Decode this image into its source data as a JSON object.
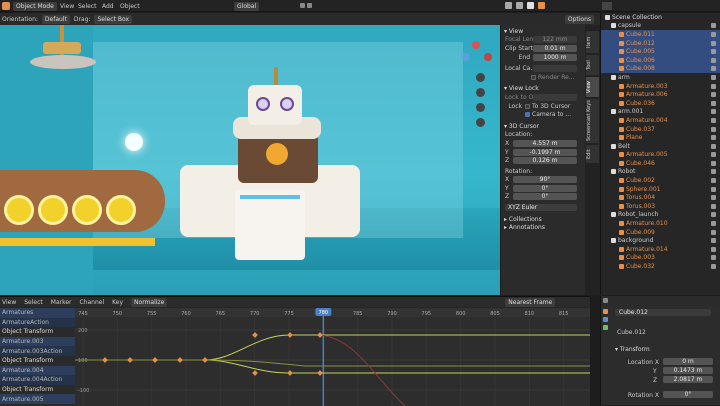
{
  "topbar": {
    "mode": "Object Mode",
    "view": "View",
    "select": "Select",
    "add": "Add",
    "object": "Object",
    "transform": "Global",
    "options": "Options"
  },
  "toolbar": {
    "orientation": "Orientation:",
    "default": "Default",
    "drag": "Drag:",
    "select_box": "Select Box"
  },
  "npanel": {
    "view_header": "View",
    "focal_label": "Focal Length",
    "focal_value": "122 mm",
    "clip_start_label": "Clip Start",
    "clip_start_value": "0.01 m",
    "end_label": "End",
    "end_value": "1000 m",
    "local_camera_label": "Local Ca...",
    "render_region": "Render Re...",
    "view_lock_header": "View Lock",
    "lock_to_object": "Lock to O...",
    "lock_label": "Lock",
    "to_3d_cursor": "To 3D Cursor",
    "camera_to_view": "Camera to ...",
    "cursor_header": "3D Cursor",
    "location_label": "Location:",
    "cursor_x": "4.557 m",
    "cursor_y": "-0.1997 m",
    "cursor_z": "0.126 m",
    "rotation_label": "Rotation:",
    "rot_x": "90°",
    "rot_y": "0°",
    "rot_z": "0°",
    "rotation_mode": "XYZ Euler",
    "collections": "Collections",
    "annotations": "Annotations"
  },
  "side_tabs": [
    "Item",
    "Tool",
    "View",
    "Screencast Keys",
    "Edit"
  ],
  "outliner": {
    "title": "Scene Collection",
    "items": [
      {
        "label": "capsule",
        "kind": "collection"
      },
      {
        "label": "Cube.011",
        "kind": "mesh"
      },
      {
        "label": "Cube.012",
        "kind": "mesh"
      },
      {
        "label": "Cube.005",
        "kind": "mesh"
      },
      {
        "label": "Cube.006",
        "kind": "mesh"
      },
      {
        "label": "Cube.008",
        "kind": "mesh"
      },
      {
        "label": "arm",
        "kind": "collection"
      },
      {
        "label": "Armature.003",
        "kind": "armature"
      },
      {
        "label": "Armature.006",
        "kind": "armature"
      },
      {
        "label": "Cube.036",
        "kind": "mesh"
      },
      {
        "label": "arm.001",
        "kind": "collection"
      },
      {
        "label": "Armature.004",
        "kind": "armature"
      },
      {
        "label": "Cube.037",
        "kind": "mesh"
      },
      {
        "label": "Plane",
        "kind": "mesh"
      },
      {
        "label": "Belt",
        "kind": "collection"
      },
      {
        "label": "Armature.005",
        "kind": "armature"
      },
      {
        "label": "Cube.046",
        "kind": "mesh"
      },
      {
        "label": "Robot",
        "kind": "collection"
      },
      {
        "label": "Cube.002",
        "kind": "mesh"
      },
      {
        "label": "Sphere.001",
        "kind": "mesh"
      },
      {
        "label": "Torus.004",
        "kind": "mesh"
      },
      {
        "label": "Torus.003",
        "kind": "mesh"
      },
      {
        "label": "Robot_launch",
        "kind": "collection"
      },
      {
        "label": "Armature.010",
        "kind": "armature"
      },
      {
        "label": "Cube.009",
        "kind": "mesh"
      },
      {
        "label": "background",
        "kind": "collection"
      },
      {
        "label": "Armature.014",
        "kind": "armature"
      },
      {
        "label": "Cube.003",
        "kind": "mesh"
      },
      {
        "label": "Cube.032",
        "kind": "mesh"
      }
    ]
  },
  "timeline": {
    "menu": [
      "View",
      "Select",
      "Marker",
      "Channel",
      "Key"
    ],
    "normalize": "Normalize",
    "snap": "Nearest Frame",
    "frames": [
      "745",
      "750",
      "755",
      "760",
      "765",
      "770",
      "775",
      "780",
      "785",
      "790",
      "795",
      "800",
      "805",
      "810",
      "815"
    ],
    "y_ticks": [
      "200",
      "100",
      "-100"
    ],
    "channels": [
      "Armatures",
      "ArmatureAction",
      "Object Transform",
      "Armature.003",
      "Armature.003Action",
      "Object Transform",
      "Armature.004",
      "Armature.004Action",
      "Object Transform",
      "Armature.005"
    ],
    "current_frame": "780"
  },
  "props": {
    "object_name": "Cube.012",
    "data_name": "Cube.012",
    "section": "Transform",
    "location_label": "Location X",
    "loc_x": "0 m",
    "loc_y": "0.1473 m",
    "loc_z": "2.0817 m",
    "rotation_label": "Rotation X",
    "rot_x": "0°"
  },
  "colors": {
    "accent": "#e8904a",
    "selected": "#334d80",
    "viewport_bg": "#36b7cc",
    "keyframe": "#e8904a"
  }
}
